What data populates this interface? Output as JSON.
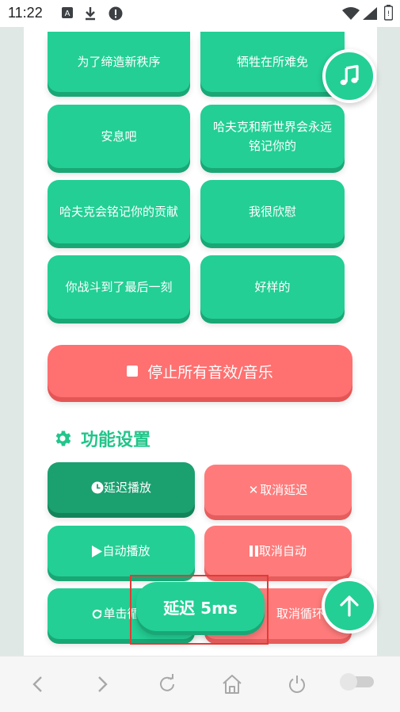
{
  "status_bar": {
    "time": "11:22"
  },
  "sound_buttons": [
    {
      "label": "为了缔造新秩序"
    },
    {
      "label": "牺牲在所难免"
    },
    {
      "label": "安息吧"
    },
    {
      "label": "哈夫克和新世界会永远铭记你的"
    },
    {
      "label": "哈夫克会铭记你的贡献"
    },
    {
      "label": "我很欣慰"
    },
    {
      "label": "你战斗到了最后一刻"
    },
    {
      "label": "好样的"
    }
  ],
  "stop_button": {
    "label": "停止所有音效/音乐"
  },
  "settings": {
    "title": "功能设置",
    "buttons": [
      {
        "label": "延迟播放"
      },
      {
        "label": "取消延迟"
      },
      {
        "label": "自动播放"
      },
      {
        "label": "取消自动"
      },
      {
        "label": "单击循环"
      },
      {
        "label": "取消循环"
      }
    ]
  },
  "toast": {
    "text": "延迟 5ms"
  },
  "colors": {
    "accent": "#23cf94",
    "danger": "#ff7070"
  },
  "icons": [
    "music-note-icon",
    "arrow-up-icon",
    "gear-icon",
    "clock-icon",
    "x-icon",
    "play-icon",
    "pause-icon",
    "redo-icon",
    "back-icon",
    "forward-icon",
    "refresh-icon",
    "home-icon",
    "power-icon"
  ]
}
